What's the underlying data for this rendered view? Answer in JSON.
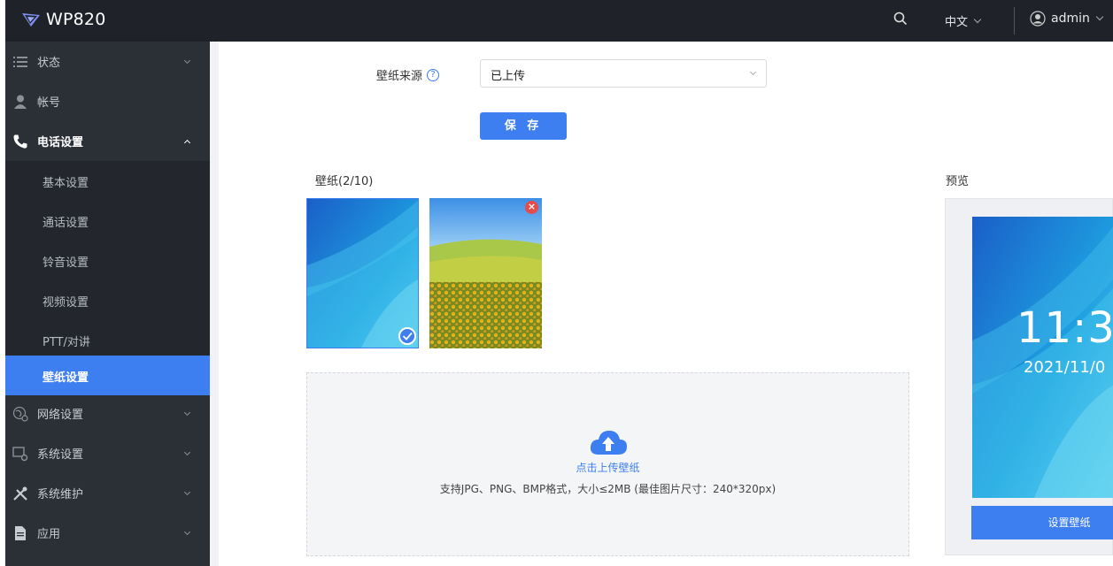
{
  "app": {
    "title": "WP820"
  },
  "topbar": {
    "search_icon": "search-icon",
    "language": "中文",
    "user": "admin"
  },
  "sidebar": {
    "items": [
      {
        "label": "状态",
        "icon": "list-icon"
      },
      {
        "label": "帐号",
        "icon": "user-icon"
      },
      {
        "label": "电话设置",
        "icon": "phone-icon"
      },
      {
        "label": "网络设置",
        "icon": "network-icon"
      },
      {
        "label": "系统设置",
        "icon": "settings-icon"
      },
      {
        "label": "系统维护",
        "icon": "tools-icon"
      },
      {
        "label": "应用",
        "icon": "document-icon"
      }
    ],
    "subitems": [
      "基本设置",
      "通话设置",
      "铃音设置",
      "视频设置",
      "PTT/对讲",
      "壁纸设置"
    ]
  },
  "form": {
    "source_label": "壁纸来源",
    "source_value": "已上传",
    "save_label": "保 存"
  },
  "wallpapers": {
    "title": "壁纸(2/10)"
  },
  "upload": {
    "title": "点击上传壁纸",
    "hint": "支持JPG、PNG、BMP格式，大小≤2MB (最佳图片尺寸：240*320px)"
  },
  "preview": {
    "title": "预览",
    "time": "11:3",
    "date": "2021/11/0",
    "set_label": "设置壁纸"
  },
  "colors": {
    "accent": "#3d7ef0",
    "sidebar": "#2b2f36",
    "topbar": "#1f2329"
  }
}
